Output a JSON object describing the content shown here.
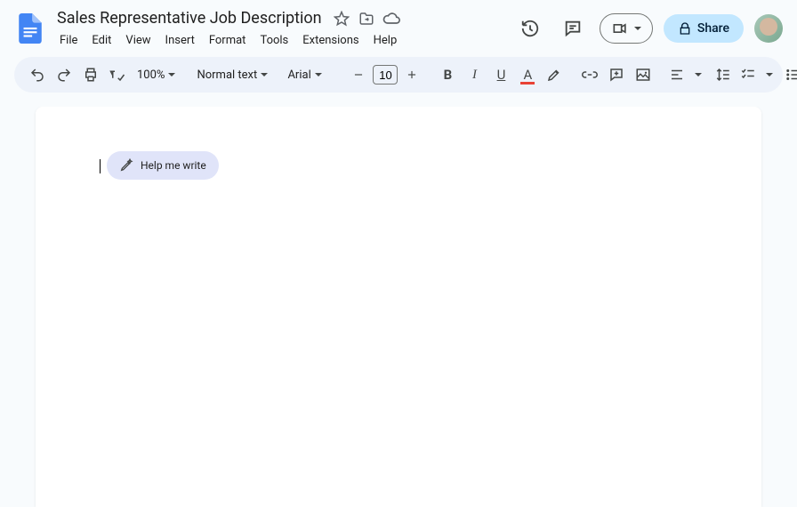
{
  "doc": {
    "title": "Sales Representative Job Description"
  },
  "menu": {
    "file": "File",
    "edit": "Edit",
    "view": "View",
    "insert": "Insert",
    "format": "Format",
    "tools": "Tools",
    "extensions": "Extensions",
    "help": "Help"
  },
  "actions": {
    "share": "Share"
  },
  "toolbar": {
    "zoom": "100%",
    "style": "Normal text",
    "font": "Arial",
    "font_size": "10"
  },
  "assist": {
    "help_me_write": "Help me write"
  }
}
